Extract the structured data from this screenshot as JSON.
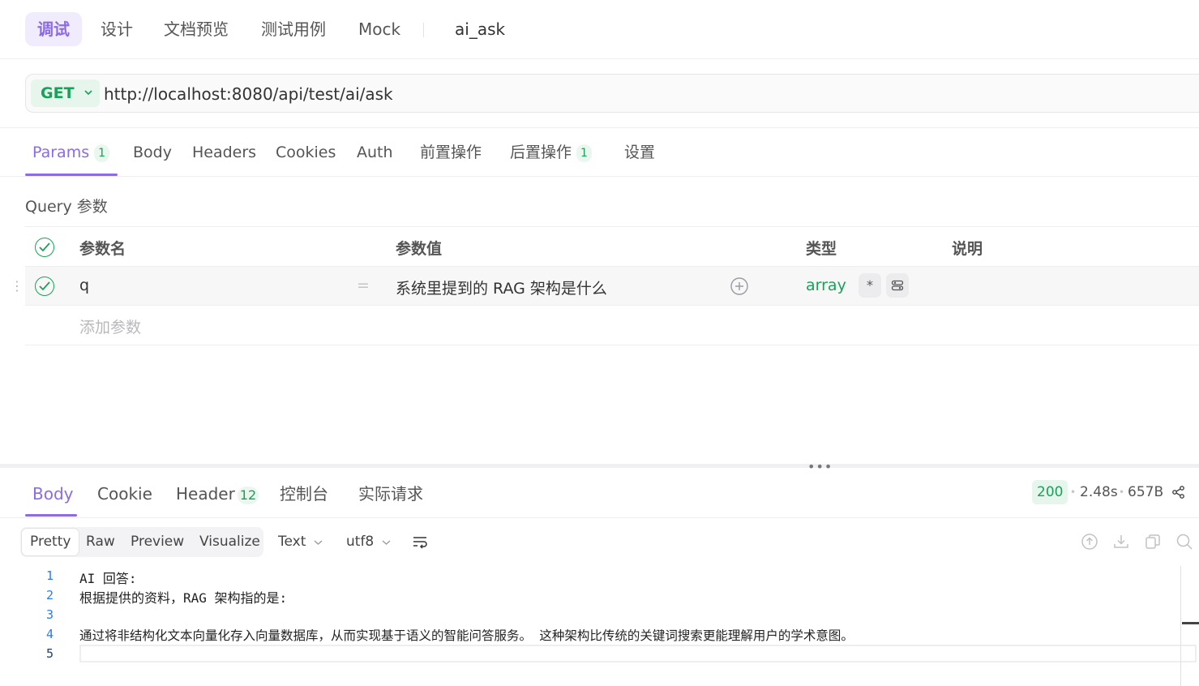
{
  "top_tabs": {
    "debug": "调试",
    "design": "设计",
    "doc_preview": "文档预览",
    "test_cases": "测试用例",
    "mock": "Mock",
    "endpoint_name": "ai_ask"
  },
  "request": {
    "method": "GET",
    "url": "http://localhost:8080/api/test/ai/ask"
  },
  "request_tabs": {
    "params": "Params",
    "params_count": "1",
    "body": "Body",
    "headers": "Headers",
    "cookies": "Cookies",
    "auth": "Auth",
    "pre_ops": "前置操作",
    "post_ops": "后置操作",
    "post_ops_count": "1",
    "settings": "设置"
  },
  "query": {
    "section_title": "Query 参数",
    "columns": {
      "name": "参数名",
      "value": "参数值",
      "type": "类型",
      "desc": "说明"
    },
    "rows": [
      {
        "name": "q",
        "eq": "=",
        "value": "系统里提到的 RAG 架构是什么",
        "type": "array",
        "required_mark": "*"
      }
    ],
    "add_placeholder": "添加参数"
  },
  "splitter": {
    "dots": "•••"
  },
  "response_tabs": {
    "body": "Body",
    "cookie": "Cookie",
    "header": "Header",
    "header_count": "12",
    "console": "控制台",
    "actual_request": "实际请求"
  },
  "response_meta": {
    "status": "200",
    "time": "2.48s",
    "size": "657B"
  },
  "view_modes": {
    "pretty": "Pretty",
    "raw": "Raw",
    "preview": "Preview",
    "visualize": "Visualize",
    "format": "Text",
    "encoding": "utf8"
  },
  "code_lines": [
    {
      "n": "1",
      "text": "AI 回答:"
    },
    {
      "n": "2",
      "text": "根据提供的资料，RAG 架构指的是:"
    },
    {
      "n": "3",
      "text": ""
    },
    {
      "n": "4",
      "text": "通过将非结构化文本向量化存入向量数据库，从而实现基于语义的智能问答服务。 这种架构比传统的关键词搜索更能理解用户的学术意图。"
    },
    {
      "n": "5",
      "text": ""
    }
  ],
  "colors": {
    "accent": "#8c6be6",
    "success": "#1aa05a"
  }
}
